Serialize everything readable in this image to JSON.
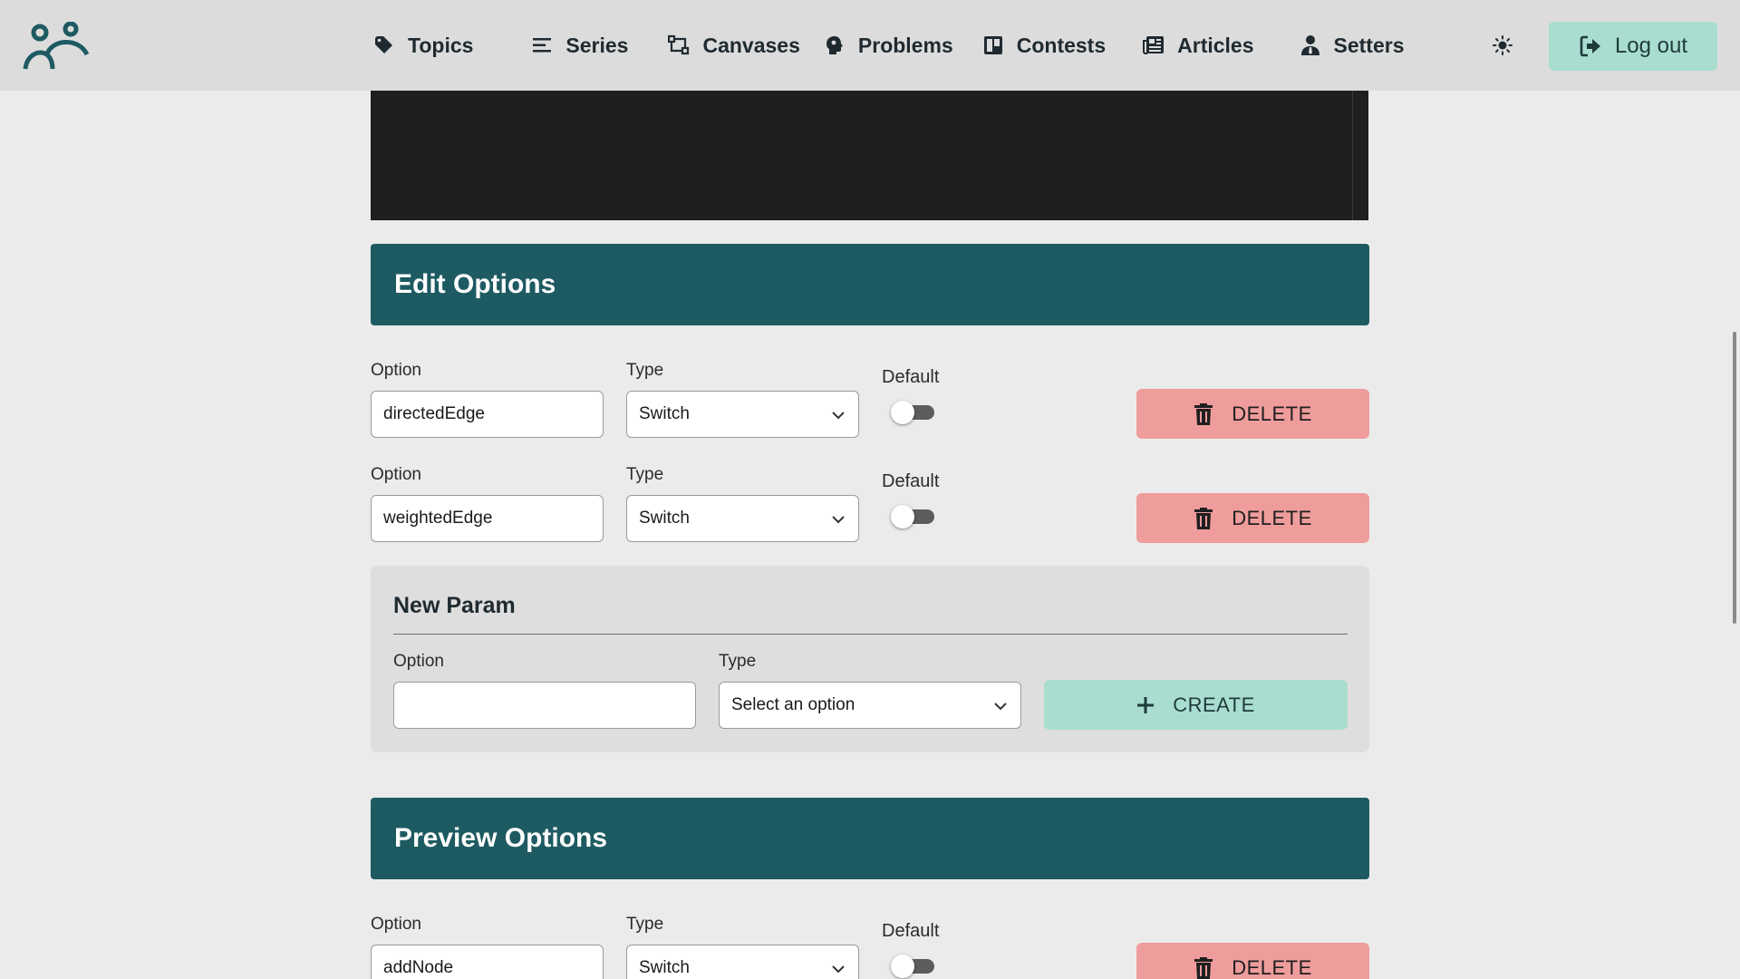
{
  "nav": {
    "items": [
      {
        "label": "Topics",
        "icon": "tag-icon"
      },
      {
        "label": "Series",
        "icon": "list-icon"
      },
      {
        "label": "Canvases",
        "icon": "canvas-icon"
      },
      {
        "label": "Problems",
        "icon": "brain-icon"
      },
      {
        "label": "Contests",
        "icon": "board-icon"
      },
      {
        "label": "Articles",
        "icon": "newspaper-icon"
      },
      {
        "label": "Setters",
        "icon": "user-tie-icon"
      }
    ],
    "theme_icon": "sun-icon",
    "logout_label": "Log out"
  },
  "colors": {
    "header_bg": "#1e5a62",
    "delete_bg": "#ef9c9c",
    "create_bg": "#a8ddd0",
    "nav_bg": "#dcdcdc"
  },
  "edit_options": {
    "title": "Edit Options",
    "labels": {
      "option": "Option",
      "type": "Type",
      "default": "Default"
    },
    "rows": [
      {
        "option": "directedEdge",
        "type": "Switch",
        "default": false,
        "delete_label": "DELETE"
      },
      {
        "option": "weightedEdge",
        "type": "Switch",
        "default": false,
        "delete_label": "DELETE"
      }
    ]
  },
  "new_param": {
    "title": "New Param",
    "option_label": "Option",
    "option_value": "",
    "type_label": "Type",
    "type_placeholder": "Select an option",
    "create_label": "CREATE"
  },
  "preview_options": {
    "title": "Preview Options",
    "labels": {
      "option": "Option",
      "type": "Type",
      "default": "Default"
    },
    "rows": [
      {
        "option": "addNode",
        "type": "Switch",
        "default": false,
        "delete_label": "DELETE"
      }
    ]
  }
}
